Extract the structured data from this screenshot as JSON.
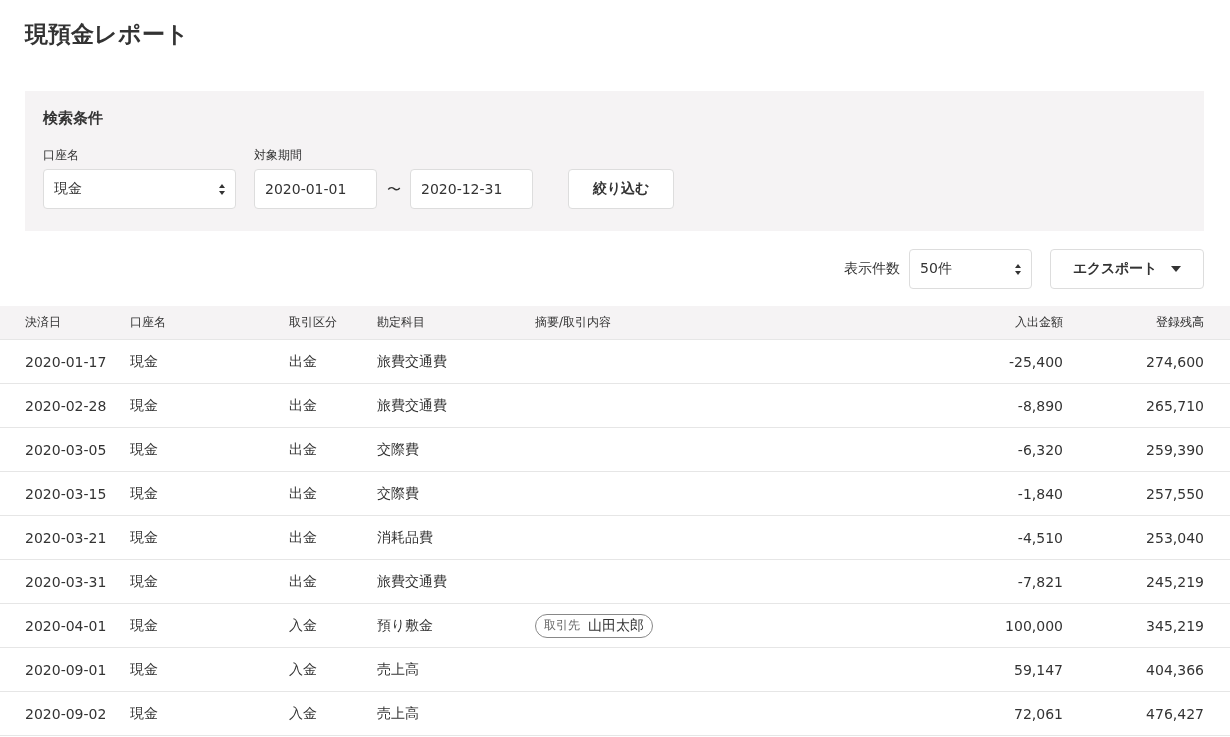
{
  "title": "現預金レポート",
  "filter": {
    "heading": "検索条件",
    "account_label": "口座名",
    "account_value": "現金",
    "period_label": "対象期間",
    "from": "2020-01-01",
    "separator": "〜",
    "to": "2020-12-31",
    "submit": "絞り込む"
  },
  "toolbar": {
    "count_label": "表示件数",
    "count_value": "50件",
    "export": "エクスポート"
  },
  "table": {
    "columns": [
      "決済日",
      "口座名",
      "取引区分",
      "勘定科目",
      "摘要/取引内容",
      "入出金額",
      "登録残高"
    ],
    "rows": [
      {
        "date": "2020-01-17",
        "account": "現金",
        "type": "出金",
        "item": "旅費交通費",
        "amount": "-25,400",
        "balance": "274,600"
      },
      {
        "date": "2020-02-28",
        "account": "現金",
        "type": "出金",
        "item": "旅費交通費",
        "amount": "-8,890",
        "balance": "265,710"
      },
      {
        "date": "2020-03-05",
        "account": "現金",
        "type": "出金",
        "item": "交際費",
        "amount": "-6,320",
        "balance": "259,390"
      },
      {
        "date": "2020-03-15",
        "account": "現金",
        "type": "出金",
        "item": "交際費",
        "amount": "-1,840",
        "balance": "257,550"
      },
      {
        "date": "2020-03-21",
        "account": "現金",
        "type": "出金",
        "item": "消耗品費",
        "amount": "-4,510",
        "balance": "253,040"
      },
      {
        "date": "2020-03-31",
        "account": "現金",
        "type": "出金",
        "item": "旅費交通費",
        "amount": "-7,821",
        "balance": "245,219"
      },
      {
        "date": "2020-04-01",
        "account": "現金",
        "type": "入金",
        "item": "預り敷金",
        "partner": {
          "label": "取引先",
          "name": "山田太郎"
        },
        "amount": "100,000",
        "balance": "345,219"
      },
      {
        "date": "2020-09-01",
        "account": "現金",
        "type": "入金",
        "item": "売上高",
        "amount": "59,147",
        "balance": "404,366"
      },
      {
        "date": "2020-09-02",
        "account": "現金",
        "type": "入金",
        "item": "売上高",
        "amount": "72,061",
        "balance": "476,427"
      }
    ]
  }
}
